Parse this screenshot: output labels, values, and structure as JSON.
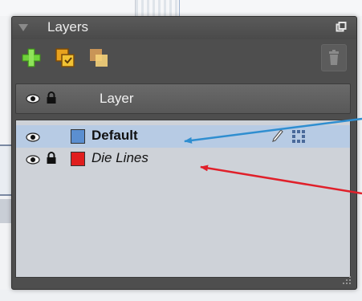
{
  "panel": {
    "title": "Layers",
    "header_label": "Layer"
  },
  "toolbar": {
    "icons": [
      "add-layer-icon",
      "duplicate-layer-icon",
      "merge-layer-icon",
      "trash-icon"
    ]
  },
  "layers": [
    {
      "name": "Default",
      "color": "#5b8fd0",
      "visible": true,
      "locked": false,
      "selected": true
    },
    {
      "name": "Die Lines",
      "color": "#e01e1e",
      "visible": true,
      "locked": true,
      "selected": false
    }
  ],
  "colors": {
    "blue_arrow": "#2f8ed0",
    "red_arrow": "#e0202a",
    "selection": "#b7cbe4"
  }
}
